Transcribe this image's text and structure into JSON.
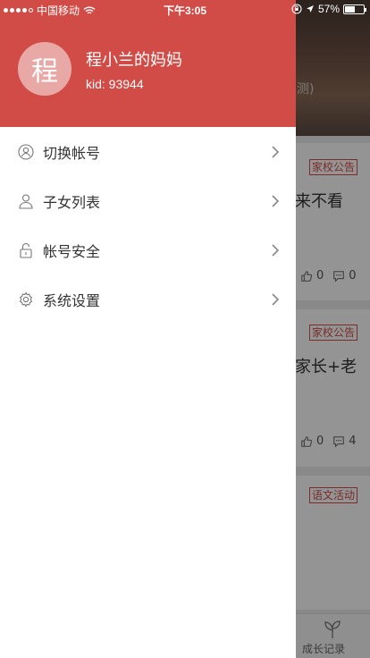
{
  "status_bar": {
    "carrier": "中国移动",
    "time": "下午3:05",
    "battery": "57%",
    "battery_level": 0.57
  },
  "profile": {
    "avatar_char": "程",
    "name": "程小兰的妈妈",
    "kid": "kid: 93944"
  },
  "menu": {
    "items": [
      {
        "label": "切换帐号",
        "icon": "switch-account-icon"
      },
      {
        "label": "子女列表",
        "icon": "person-icon"
      },
      {
        "label": "帐号安全",
        "icon": "lock-icon"
      },
      {
        "label": "系统设置",
        "icon": "gear-icon"
      }
    ]
  },
  "background": {
    "hero_text": "测)",
    "cards": [
      {
        "tag": "家校公告",
        "title": "来不看",
        "likes": "0",
        "comments": "0"
      },
      {
        "tag": "家校公告",
        "title": "家长+老",
        "likes": "0",
        "comments": "4"
      },
      {
        "tag": "语文活动"
      }
    ],
    "tab_label": "成长记录"
  },
  "colors": {
    "header": "#d24c47",
    "avatar": "#e8a9a6",
    "tag": "#d24c47"
  }
}
